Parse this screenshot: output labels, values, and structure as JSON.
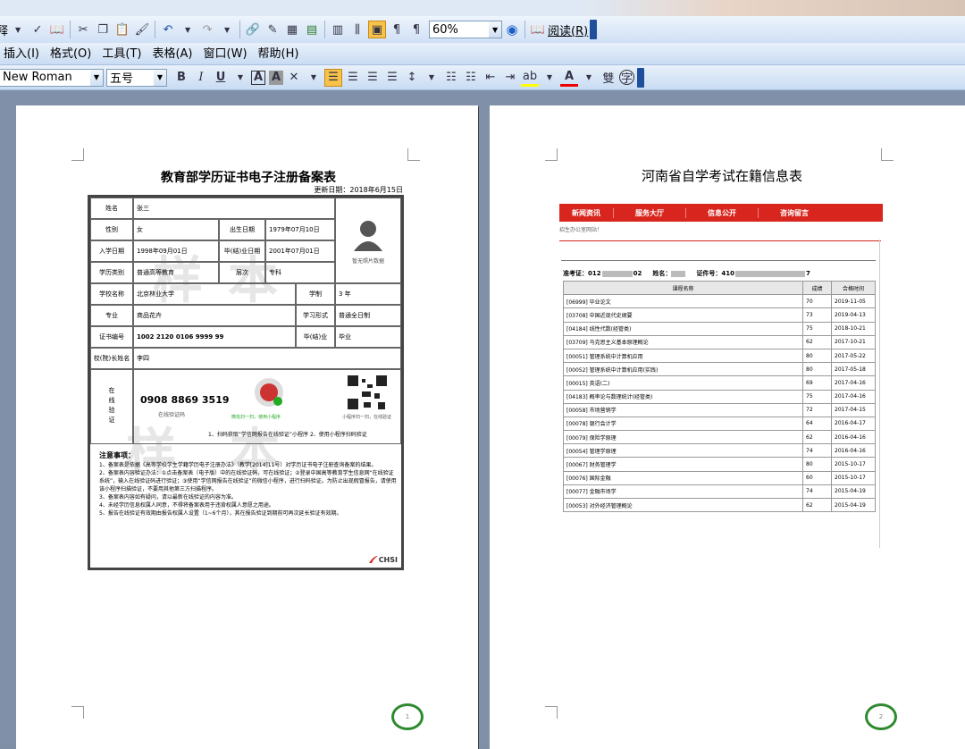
{
  "toolbar1": {
    "zoom": "60%",
    "read_label": "阅读(R)",
    "fragment": "释"
  },
  "menu": {
    "items": [
      "插入(I)",
      "格式(O)",
      "工具(T)",
      "表格(A)",
      "窗口(W)",
      "帮助(H)"
    ]
  },
  "format_bar": {
    "font": "New Roman",
    "size": "五号",
    "bold": "B",
    "italic": "I",
    "underline": "U",
    "char_border": "A",
    "char_shade": "A"
  },
  "page1": {
    "title": "教育部学历证书电子注册备案表",
    "update_date": "更新日期：2018年6月15日",
    "watermark": "样本",
    "page_number": "1",
    "fields": {
      "name_label": "姓名",
      "name": "张三",
      "gender_label": "性别",
      "gender": "女",
      "birth_label": "出生日期",
      "birth": "1979年07月10日",
      "enroll_label": "入学日期",
      "enroll": "1998年09月01日",
      "grad_label": "毕(结)业日期",
      "grad": "2001年07月01日",
      "type_label": "学历类别",
      "type": "普通高等教育",
      "level_label": "层次",
      "level": "专科",
      "school_label": "学校名称",
      "school": "北京林业大学",
      "duration_label": "学制",
      "duration": "3 年",
      "major_label": "专业",
      "major": "商品花卉",
      "form_label": "学习形式",
      "form": "普通全日制",
      "cert_label": "证书编号",
      "cert": "1002 2120 0106 9999 99",
      "status_label": "毕(结)业",
      "status": "毕业",
      "president_label": "校(院)长姓名",
      "president": "李四",
      "no_photo": "暂无照片数据",
      "online_label": "在线验证",
      "code": "0908 8869 3519",
      "code_label": "在线验证码",
      "wechat_label": "微信扫一扫，使用小程序",
      "qr_label": "小程序扫一扫，在线验证",
      "steps": "1、扫码获取“学信网报告在线验证”小程序 2、使用小程序扫码验证",
      "notes_title": "注意事项：",
      "notes": [
        "1、备案表是依据《高等学校学生学籍学历电子注册办法》（教学[2014]11号）对学历证书电子注册查询备案的结果。",
        "2、备案表内容验证办法：①点击备案表（电子版）中的在线验证码，可在线验证；②登录中国高等教育学生信息网“在线验证系统”，输入在线验证码进行验证；③使用“学信网报告在线验证”的微信小程序，进行扫码验证。为防止出现假冒报告，请使用该小程序扫描验证，不要用其他第三方扫描程序。",
        "3、备案表内容如有疑问，请以最新在线验证的内容为准。",
        "4、未经学历信息权属人同意，不得将备案表用于违背权属人意愿之用途。",
        "5、报告在线验证有效期由报告权属人设置（1~6个月），其在报告验证到期前可再次延长验证有效期。"
      ],
      "logo": "CHSI"
    }
  },
  "page2": {
    "title": "河南省自学考试在籍信息表",
    "nav": [
      "新闻资讯",
      "服务大厅",
      "信息公开",
      "咨询留言"
    ],
    "office_text": "招生办公室网站！",
    "info": {
      "exam_no": "准考证：012",
      "exam_no_end": "02",
      "name_label": "姓名：",
      "id_label": "证件号：410",
      "id_end": "7"
    },
    "table_headers": [
      "课程名称",
      "成绩",
      "合格时间"
    ],
    "rows": [
      [
        "[06999] 毕业论文",
        "70",
        "2019-11-05"
      ],
      [
        "[03708] 中国近现代史纲要",
        "73",
        "2019-04-13"
      ],
      [
        "[04184] 线性代数(经管类)",
        "75",
        "2018-10-21"
      ],
      [
        "[03709] 马克思主义基本原理概论",
        "62",
        "2017-10-21"
      ],
      [
        "[00051] 管理系统中计算机应用",
        "80",
        "2017-05-22"
      ],
      [
        "[00052] 管理系统中计算机应用(实践)",
        "80",
        "2017-05-18"
      ],
      [
        "[00015] 英语(二)",
        "69",
        "2017-04-16"
      ],
      [
        "[04183] 概率论与数理统计(经管类)",
        "75",
        "2017-04-16"
      ],
      [
        "[00058] 市场营销学",
        "72",
        "2017-04-15"
      ],
      [
        "[00078] 银行会计学",
        "64",
        "2016-04-17"
      ],
      [
        "[00079] 保险学原理",
        "62",
        "2016-04-16"
      ],
      [
        "[00054] 管理学原理",
        "74",
        "2016-04-16"
      ],
      [
        "[00067] 财务管理学",
        "80",
        "2015-10-17"
      ],
      [
        "[00076] 国际金融",
        "60",
        "2015-10-17"
      ],
      [
        "[00077] 金融市场学",
        "74",
        "2015-04-19"
      ],
      [
        "[00053] 对外经济管理概论",
        "62",
        "2015-04-19"
      ]
    ],
    "page_number": "2"
  },
  "colors": {
    "nav_red": "#d8261e",
    "page_circle": "#2f8a2f",
    "toolbar": "#c9dcf3"
  }
}
